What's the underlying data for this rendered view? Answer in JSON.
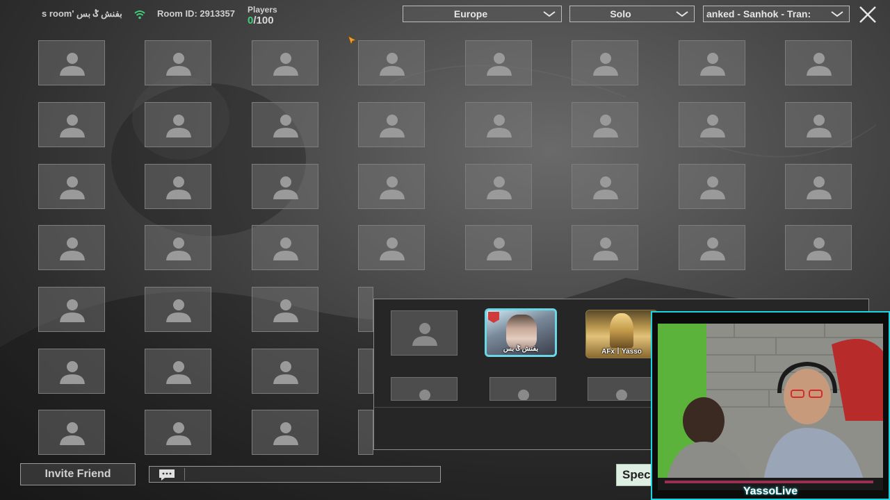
{
  "topbar": {
    "room_name": "s room' بفنش ݣ بس",
    "room_id": "Room ID: 2913357",
    "players_label": "Players",
    "players_current": "0",
    "players_max": "/100"
  },
  "filters": {
    "region": "Europe",
    "mode": "Solo",
    "map": "anked - Sanhok - Tran:"
  },
  "team_panel": {
    "player1_name": "بفنش ݣ بس",
    "player2_name": "AFx丨Yasso"
  },
  "bottom": {
    "invite_label": "Invite Friend",
    "chat_placeholder": "",
    "spectate_label": "Spec"
  },
  "stream": {
    "channel_name": "YassoLive"
  },
  "colors": {
    "players_current": "#3fd07a",
    "webcam_border": "#1ad6e2",
    "wifi": "#3fd07a"
  },
  "icons": {
    "wifi": "wifi-icon",
    "chevron": "chevron-down-icon",
    "close": "close-icon",
    "empty_slot": "person-silhouette-icon",
    "chat": "chat-bubble-icon"
  }
}
